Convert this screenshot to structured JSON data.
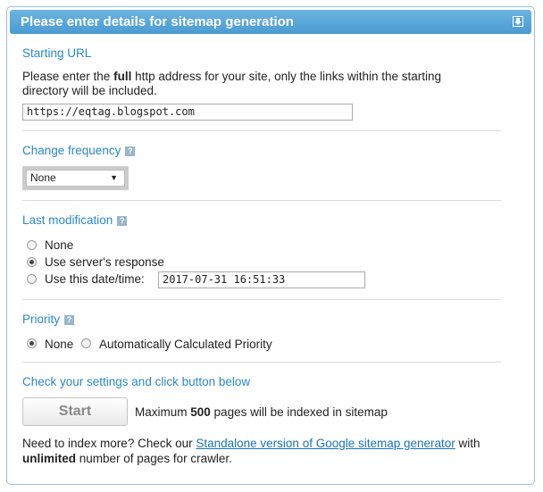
{
  "header": {
    "title": "Please enter details for sitemap generation",
    "collapse_icon": "collapse-arrow-icon"
  },
  "starting_url": {
    "title": "Starting URL",
    "desc_prefix": "Please enter the ",
    "desc_bold": "full",
    "desc_line1_rest": " http address for your site, only the links within the starting",
    "desc_line2": "directory will be included.",
    "value": "https://eqtag.blogspot.com"
  },
  "change_frequency": {
    "title": "Change frequency",
    "help": "?",
    "selected": "None"
  },
  "last_modification": {
    "title": "Last modification",
    "help": "?",
    "options": [
      "None",
      "Use server's response",
      "Use this date/time:"
    ],
    "selected_index": 1,
    "datetime_value": "2017-07-31 16:51:33"
  },
  "priority": {
    "title": "Priority",
    "help": "?",
    "options": [
      "None",
      "Automatically Calculated Priority"
    ],
    "selected_index": 0
  },
  "settings": {
    "title": "Check your settings and click button below",
    "start_label": "Start",
    "max_prefix": "Maximum ",
    "max_count": "500",
    "max_suffix": " pages will be indexed in sitemap",
    "more_prefix": "Need to index more? Check our ",
    "more_link": "Standalone version of Google sitemap generator",
    "more_suffix": " with",
    "unlimited_bold": "unlimited",
    "unlimited_rest": " number of pages for crawler."
  }
}
